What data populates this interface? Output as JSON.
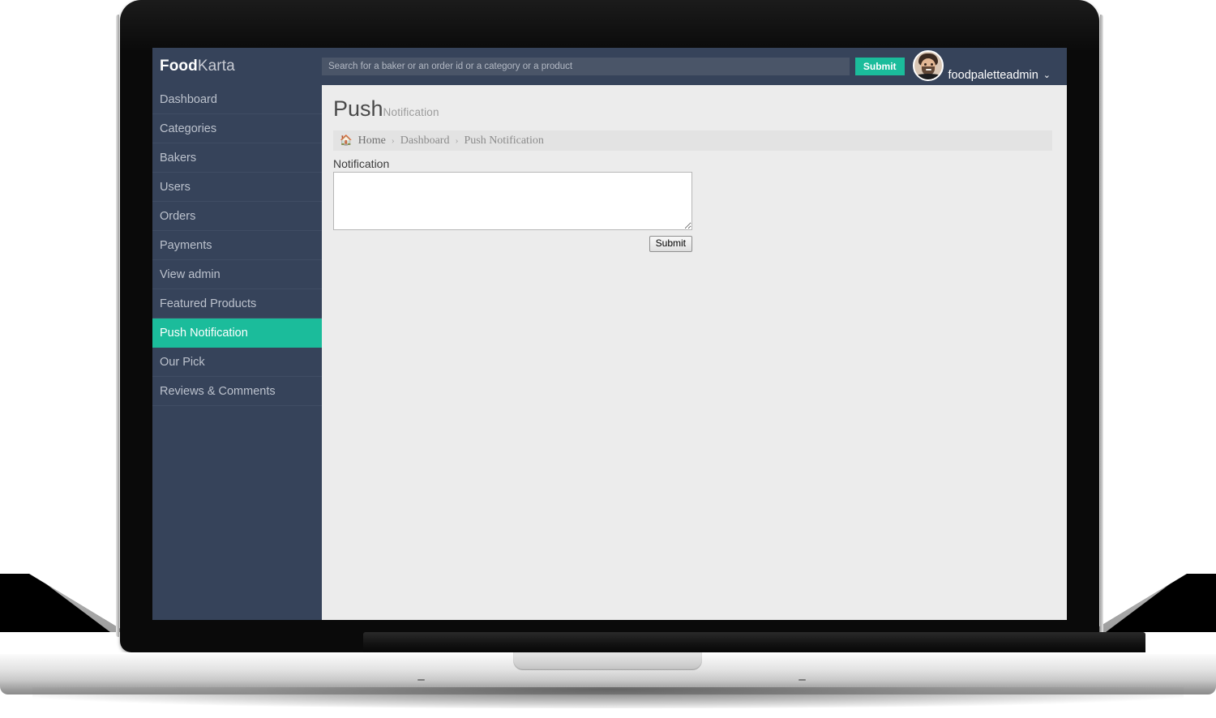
{
  "brand": {
    "strong": "Food",
    "light": "Karta"
  },
  "search": {
    "placeholder": "Search for a baker or an order id or a category or a product",
    "value": "",
    "submit_label": "Submit"
  },
  "user": {
    "name": "foodpaletteadmin",
    "caret": "⌄",
    "avatar_icon": "user-avatar-photo"
  },
  "sidebar": {
    "items": [
      {
        "label": "Dashboard",
        "active": false
      },
      {
        "label": "Categories",
        "active": false
      },
      {
        "label": "Bakers",
        "active": false
      },
      {
        "label": "Users",
        "active": false
      },
      {
        "label": "Orders",
        "active": false
      },
      {
        "label": "Payments",
        "active": false
      },
      {
        "label": "View admin",
        "active": false
      },
      {
        "label": "Featured Products",
        "active": false
      },
      {
        "label": "Push Notification",
        "active": true
      },
      {
        "label": "Our Pick",
        "active": false
      },
      {
        "label": "Reviews & Comments",
        "active": false
      }
    ]
  },
  "page": {
    "title_main": "Push",
    "title_sub": "Notification"
  },
  "breadcrumb": {
    "home_icon": "🏠",
    "items": [
      {
        "label": "Home"
      },
      {
        "label": "Dashboard"
      },
      {
        "label": "Push Notification"
      }
    ],
    "separator": "›"
  },
  "form": {
    "notification_label": "Notification",
    "notification_value": "",
    "notification_placeholder": "",
    "submit_label": "Submit"
  },
  "colors": {
    "sidebar_bg": "#36435a",
    "accent": "#1bbc9b",
    "content_bg": "#ececec",
    "breadcrumb_bg": "#e3e3e3",
    "nav_text": "#bcc2cd"
  }
}
